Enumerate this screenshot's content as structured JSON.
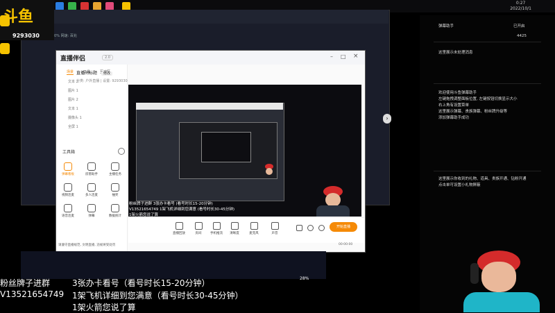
{
  "taskbar": {
    "time": "0:27",
    "date": "2022/10/1"
  },
  "overlay": {
    "logo_text": "斗鱼",
    "room_id": "9293030",
    "bg_title": "直播伴侣·弹幕助手",
    "bg_stats": "发包: 0.0%   网速: 百兆"
  },
  "app": {
    "brand": "直播伴侣",
    "version": "2.0",
    "tabs": [
      "场景",
      "工具",
      "互动区"
    ],
    "scenes": [
      "文本 2",
      "图片 1",
      "图片 2",
      "文本 1",
      "摄像头 1",
      "全屏 1"
    ],
    "toolbox_title": "工具箱",
    "tools": [
      "弹幕看板",
      "房管助手",
      "主播任务",
      "视频连麦",
      "多人连麦",
      "抽奖",
      "语音连麦",
      "弹幕",
      "数据统计"
    ],
    "stream_title": "直播间标题",
    "stream_title_button": "修改",
    "category": "分类: 户外直播 | 设置: 9293030",
    "notice": "请遵守直播规范, 文明直播, 违规将受处罚",
    "preview_overlay": [
      "粉丝牌子进群    3张办卡看号 (看号时长15-20分钟)",
      "V13521654749    1架飞机详细到您满意 (看号时长30-45分钟)",
      "                1架火箭您说了算"
    ],
    "bottom_items": [
      "直播回放",
      "房间",
      "手机推流",
      "清晰度",
      "麦克风",
      "声音"
    ],
    "start_button": "开始直播",
    "timer": "00:00:00"
  },
  "right_panel": {
    "header": "弹幕助手",
    "header_right": "已开启",
    "likes": "4425",
    "line1": "这里展示未处理消息",
    "welcome": [
      "欢迎使用斗鱼弹幕助手",
      "左键拖拽调整面板位置, 左键按钮切换显示大小",
      "右上角有设置菜单",
      "这里展示弹幕、贵族弹幕、粉丝牌升级等",
      "添加弹幕助手成功"
    ],
    "gifts": [
      "这里展示你收到的礼物、道具、贵族开通、钻粉开通",
      "点击单可设置小礼物屏蔽"
    ]
  },
  "captions": {
    "line1_left": "粉丝牌子进群",
    "line1_right": "3张办卡看号（看号时长15-20分钟）",
    "line2_left": "V13521654749",
    "line2_right": "1架飞机详细到您满意（看号时长30-45分钟）",
    "line3": "1架火箭您说了算"
  },
  "progress_label": "28%"
}
